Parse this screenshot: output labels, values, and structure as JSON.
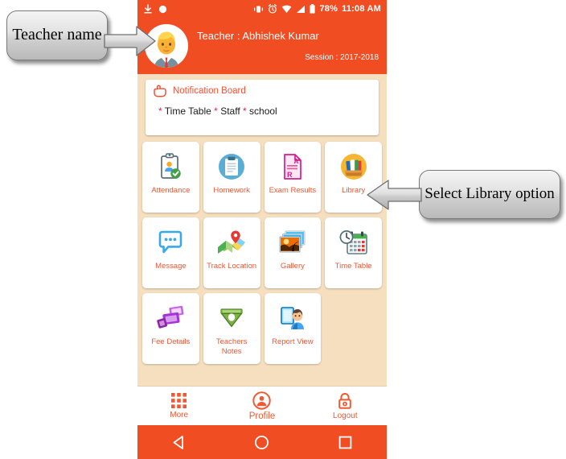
{
  "statusbar": {
    "download_icon": "download-icon",
    "record_icon": "record-dot-icon",
    "vibrate_icon": "vibrate-icon",
    "alarm_icon": "alarm-clock-icon",
    "wifi_icon": "wifi-icon",
    "signal_icon": "signal-icon",
    "battery_icon": "battery-icon",
    "battery_text": "78%",
    "time": "11:08 AM"
  },
  "header": {
    "avatar_icon": "teacher-avatar",
    "teacher_name": "Teacher : Abhishek Kumar",
    "session": "Session : 2017-2018",
    "background_color": "#f04d23"
  },
  "notification": {
    "icon": "pointing-hand-icon",
    "title": "Notification Board",
    "star": "*",
    "items": [
      "Time Table",
      "Staff",
      "school"
    ],
    "body_text": "* Time Table * Staff * school"
  },
  "grid": {
    "tiles": [
      {
        "label": "Attendance",
        "icon": "clipboard-person-check-icon"
      },
      {
        "label": "Homework",
        "icon": "clipboard-blue-circle-icon"
      },
      {
        "label": "Exam Results",
        "icon": "exam-paper-grade-icon"
      },
      {
        "label": "Library",
        "icon": "books-stack-icon"
      },
      {
        "label": "Message",
        "icon": "speech-bubble-icon"
      },
      {
        "label": "Track Location",
        "icon": "map-pin-icon"
      },
      {
        "label": "Gallery",
        "icon": "photo-stack-icon"
      },
      {
        "label": "Time Table",
        "icon": "calendar-clock-icon"
      },
      {
        "label": "Fee Details",
        "icon": "money-cards-icon"
      },
      {
        "label": "Teachers Notes",
        "icon": "green-badge-ribbon-icon"
      },
      {
        "label": "Report View",
        "icon": "person-clipboard-icon"
      }
    ],
    "label_color": "#ef5632",
    "tile_background": "#ffffff",
    "page_background": "#f5dfbf"
  },
  "bottom_nav": {
    "items": [
      {
        "label": "More",
        "icon": "grid-apps-icon"
      },
      {
        "label": "Profile",
        "icon": "person-circle-icon"
      },
      {
        "label": "Logout",
        "icon": "lock-icon"
      }
    ],
    "accent_color": "#ee5a33"
  },
  "android_nav": {
    "back_icon": "triangle-back-icon",
    "home_icon": "circle-home-icon",
    "recents_icon": "square-recents-icon"
  },
  "annotations": [
    {
      "text": "Teacher name",
      "arrow": "arrow-right",
      "target": "header-teacher-name"
    },
    {
      "text": "Select Library option",
      "arrow": "arrow-left",
      "target": "tile-library"
    }
  ]
}
